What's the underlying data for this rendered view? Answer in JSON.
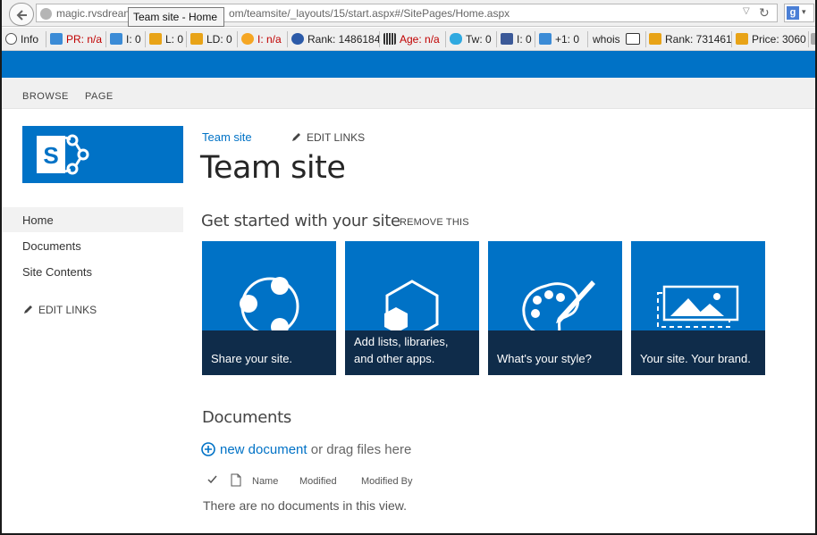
{
  "browser": {
    "url_start": "magic.rvsdrean",
    "url_end": "om/teamsite/_layouts/15/start.aspx#/SitePages/Home.aspx",
    "tooltip": "Team site - Home",
    "search_engine_letter": "g"
  },
  "toolbar": {
    "items": [
      {
        "label": "Info"
      },
      {
        "label": "PR: n/a"
      },
      {
        "label": "I: 0"
      },
      {
        "label": "L: 0"
      },
      {
        "label": "LD: 0"
      },
      {
        "label": "I: n/a"
      },
      {
        "label": "Rank: 1486184"
      },
      {
        "label": "Age: n/a"
      },
      {
        "label": "Tw: 0"
      },
      {
        "label": "I: 0"
      },
      {
        "label": "+1: 0"
      },
      {
        "label": "whois"
      },
      {
        "label": "Rank: 731461"
      },
      {
        "label": "Price: 3060"
      }
    ]
  },
  "ribbon": {
    "tabs": [
      {
        "label": "BROWSE"
      },
      {
        "label": "PAGE"
      }
    ]
  },
  "nav": {
    "items": [
      {
        "label": "Home"
      },
      {
        "label": "Documents"
      },
      {
        "label": "Site Contents"
      }
    ],
    "edit_links": "EDIT LINKS"
  },
  "main": {
    "breadcrumb": "Team site",
    "edit_links": "EDIT LINKS",
    "title": "Team site",
    "get_started": {
      "title": "Get started with your site",
      "remove": "REMOVE THIS",
      "tiles": [
        {
          "caption": "Share your site.",
          "icon": "share-icon"
        },
        {
          "caption": "Add lists, libraries, and other apps.",
          "icon": "add-apps-icon"
        },
        {
          "caption": "What's your style?",
          "icon": "palette-icon"
        },
        {
          "caption": "Your site. Your brand.",
          "icon": "brand-image-icon"
        }
      ]
    },
    "documents": {
      "title": "Documents",
      "new_link": "new document",
      "new_suffix": " or drag files here",
      "columns": [
        "Name",
        "Modified",
        "Modified By"
      ],
      "empty_message": "There are no documents in this view."
    }
  },
  "colors": {
    "accent": "#0072c6",
    "caption_bg": "#0f2c4a"
  }
}
